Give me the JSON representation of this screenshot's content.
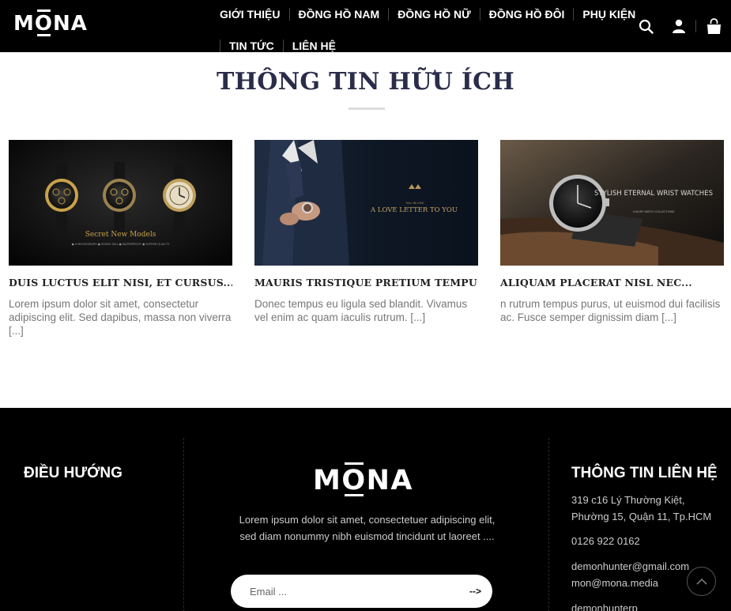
{
  "header": {
    "logo": {
      "pre": "M",
      "o": "O",
      "post": "NA"
    },
    "nav": [
      {
        "label": "GIỚI THIỆU"
      },
      {
        "label": "ĐỒNG HỒ NAM"
      },
      {
        "label": "ĐỒNG HỒ NỮ"
      },
      {
        "label": "ĐỒNG HỒ ĐÔI"
      },
      {
        "label": "PHỤ KIỆN"
      },
      {
        "label": "TIN TỨC"
      },
      {
        "label": "LIÊN HỆ"
      }
    ],
    "icons": [
      "search-icon",
      "user-icon",
      "cart-icon"
    ]
  },
  "section": {
    "title": "THÔNG TIN HỮU ÍCH"
  },
  "posts": [
    {
      "title": "DUIS LUCTUS ELIT NISI, ET CURSUS...",
      "excerpt": "Lorem ipsum dolor sit amet, consectetur adipiscing elit. Sed dapibus, massa non viverra [...]",
      "image_text": "Secret New Models",
      "image_subtext": "● CHRONOGRAPH  ● DIVING DIAL  ● WATERPROOF  ● SUPERB QUALITY"
    },
    {
      "title": "MAURIS TRISTIQUE PRETIUM TEMPUS....",
      "excerpt": "Donec tempus eu ligula sed blandit. Vivamus vel enim ac quam iaculis rutrum. [...]",
      "image_text": "A LOVE LETTER TO YOU",
      "image_subtext": "FALL IN LOVE"
    },
    {
      "title": "ALIQUAM PLACERAT NISL NEC...",
      "excerpt": "n rutrum tempus purus, ut euismod dui facilisis ac. Fusce semper dignissim diam [...]",
      "image_text": "STYLISH ETERNAL WRIST WATCHES",
      "image_subtext": "LUXURY WATCH COLLECTIONS"
    }
  ],
  "footer": {
    "nav_title": "ĐIỀU HƯỚNG",
    "logo": {
      "pre": "M",
      "o": "O",
      "post": "NA"
    },
    "description": "Lorem ipsum dolor sit amet, consectetuer adipiscing elit, sed diam nonummy nibh euismod tincidunt ut laoreet ....",
    "newsletter": {
      "placeholder": "Email ...",
      "submit_label": "-->"
    },
    "contact_title": "THÔNG TIN LIÊN HỆ",
    "address_line1": "319 c16 Lý Thường Kiệt,",
    "address_line2": "Phường 15, Quận 11, Tp.HCM",
    "phone": "0126 922 0162",
    "email1": "demonhunter@gmail.com",
    "email2": "mon@mona.media",
    "email3": "demonhunterp"
  },
  "colors": {
    "header_bg": "#000000",
    "title": "#2a2c4a",
    "footer_bg": "#000000"
  }
}
